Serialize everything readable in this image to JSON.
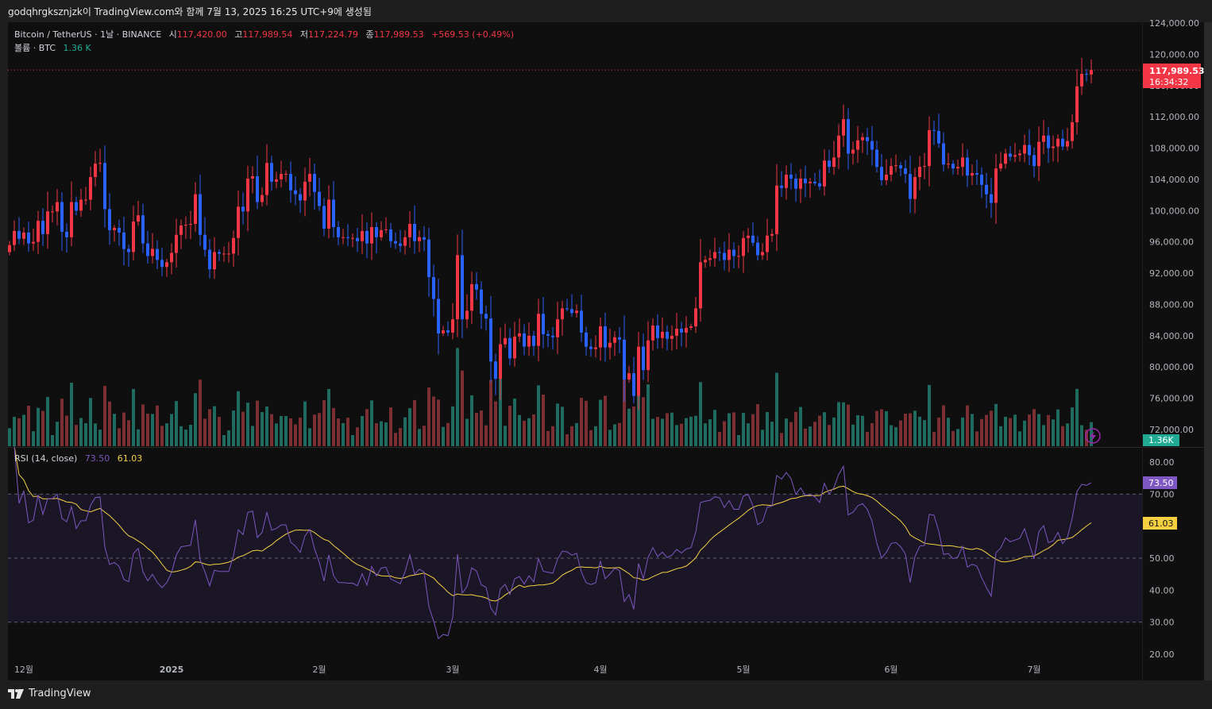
{
  "caption": "godqhrgksznjzk이 TradingView.com와 함께 7월 13, 2025 16:25 UTC+9에 생성됨",
  "legend": {
    "symbol": "Bitcoin / TetherUS · 1날 · BINANCE",
    "open_label": "시",
    "open": "117,420.00",
    "high_label": "고",
    "high": "117,989.54",
    "low_label": "저",
    "low": "117,224.79",
    "close_label": "종",
    "close": "117,989.53",
    "change": "+569.53 (+0.49%)",
    "volume_label": "볼륨 · BTC",
    "volume": "1.36 K"
  },
  "rsi_legend": {
    "label": "RSI (14, close)",
    "rsi": "73.50",
    "ma": "61.03"
  },
  "price_tag": {
    "price": "117,989.53",
    "countdown": "16:34:32"
  },
  "volume_tag": "1.36K",
  "rsi_tags": {
    "rsi": "73.50",
    "ma": "61.03"
  },
  "footer": {
    "brand": "TradingView"
  },
  "colors": {
    "up": "#f23645",
    "down": "#2962ff",
    "vol_up": "#1f6b60",
    "vol_down": "#7b2f33",
    "rsi": "#7e57c2",
    "rsi_ma": "#f5d142"
  },
  "chart_data": {
    "type": "candlestick",
    "title": "Bitcoin / TetherUS · 1D · BINANCE",
    "start_date": "2024-11-28",
    "closes": [
      95.6,
      97.4,
      96.4,
      97.2,
      95.8,
      96.0,
      98.7,
      97.0,
      99.9,
      99.9,
      101.1,
      97.3,
      96.6,
      101.1,
      100.0,
      101.4,
      101.4,
      104.3,
      106.0,
      106.1,
      100.2,
      97.5,
      97.8,
      97.2,
      95.1,
      94.7,
      98.6,
      99.4,
      95.8,
      94.2,
      95.1,
      93.7,
      92.8,
      93.4,
      94.6,
      96.9,
      98.1,
      98.2,
      98.3,
      102.1,
      96.9,
      95.0,
      92.5,
      94.7,
      94.5,
      94.5,
      94.5,
      96.5,
      100.5,
      99.9,
      104.1,
      104.4,
      101.1,
      102.0,
      106.1,
      103.7,
      104.0,
      104.7,
      104.7,
      102.6,
      102.1,
      101.3,
      103.7,
      104.7,
      102.4,
      100.6,
      97.7,
      101.4,
      97.9,
      96.6,
      96.6,
      96.5,
      96.5,
      96.1,
      97.4,
      95.8,
      97.9,
      96.6,
      97.5,
      97.6,
      96.1,
      95.8,
      95.5,
      96.6,
      98.3,
      96.1,
      96.6,
      96.3,
      91.5,
      88.7,
      84.3,
      84.7,
      84.4,
      86.1,
      94.3,
      86.1,
      87.2,
      90.6,
      89.9,
      86.8,
      86.2,
      80.7,
      78.5,
      82.9,
      83.7,
      81.1,
      83.9,
      84.3,
      82.6,
      84.0,
      82.7,
      86.8,
      84.2,
      84.0,
      83.8,
      86.1,
      87.5,
      87.4,
      86.9,
      87.2,
      84.4,
      82.6,
      82.3,
      82.5,
      85.2,
      82.5,
      83.1,
      83.8,
      83.5,
      78.4,
      79.2,
      76.3,
      82.6,
      79.6,
      83.4,
      85.3,
      83.7,
      84.5,
      83.6,
      84.0,
      84.9,
      84.4,
      85.0,
      85.2,
      87.5,
      93.4,
      93.7,
      93.9,
      94.7,
      94.6,
      93.7,
      95.0,
      94.2,
      94.2,
      96.5,
      96.8,
      95.9,
      94.3,
      94.7,
      96.8,
      97.0,
      103.2,
      102.9,
      104.6,
      104.1,
      102.8,
      104.1,
      103.5,
      103.7,
      103.5,
      103.1,
      106.4,
      105.6,
      106.8,
      109.6,
      111.7,
      107.3,
      107.8,
      109.0,
      109.4,
      108.9,
      107.8,
      105.6,
      103.9,
      104.6,
      105.7,
      105.8,
      105.4,
      104.7,
      101.5,
      104.3,
      105.6,
      105.7,
      110.3,
      110.2,
      108.6,
      105.9,
      106.0,
      105.4,
      105.6,
      106.8,
      104.5,
      104.8,
      104.6,
      103.3,
      102.1,
      101.0,
      105.4,
      106.0,
      107.3,
      106.9,
      107.1,
      107.3,
      108.4,
      107.1,
      105.7,
      108.8,
      109.6,
      108.0,
      108.2,
      109.2,
      108.2,
      108.9,
      111.3,
      115.9,
      117.5,
      117.42,
      117.99
    ],
    "close_units": "thousand USDT",
    "ylim": [
      72000,
      124000
    ],
    "y_ticks": [
      "124,000.00",
      "120,000.00",
      "116,000.00",
      "112,000.00",
      "108,000.00",
      "104,000.00",
      "100,000.00",
      "96,000.00",
      "92,000.00",
      "88,000.00",
      "84,000.00",
      "80,000.00",
      "76,000.00",
      "72,000.00"
    ],
    "x_ticks": [
      {
        "label": "12월",
        "date": "2024-12-01"
      },
      {
        "label": "2025",
        "date": "2025-01-01"
      },
      {
        "label": "2월",
        "date": "2025-02-01"
      },
      {
        "label": "3월",
        "date": "2025-03-01"
      },
      {
        "label": "4월",
        "date": "2025-04-01"
      },
      {
        "label": "5월",
        "date": "2025-05-01"
      },
      {
        "label": "6월",
        "date": "2025-06-01"
      },
      {
        "label": "7월",
        "date": "2025-07-01"
      }
    ],
    "rsi": {
      "period": 14,
      "ma_period": 14,
      "ylim": [
        20,
        80
      ],
      "bands": [
        30,
        50,
        70
      ],
      "y_ticks": [
        "80.00",
        "70.00",
        "50.00",
        "40.00",
        "30.00",
        "20.00"
      ],
      "last_rsi": 73.5,
      "last_ma": 61.03
    }
  }
}
